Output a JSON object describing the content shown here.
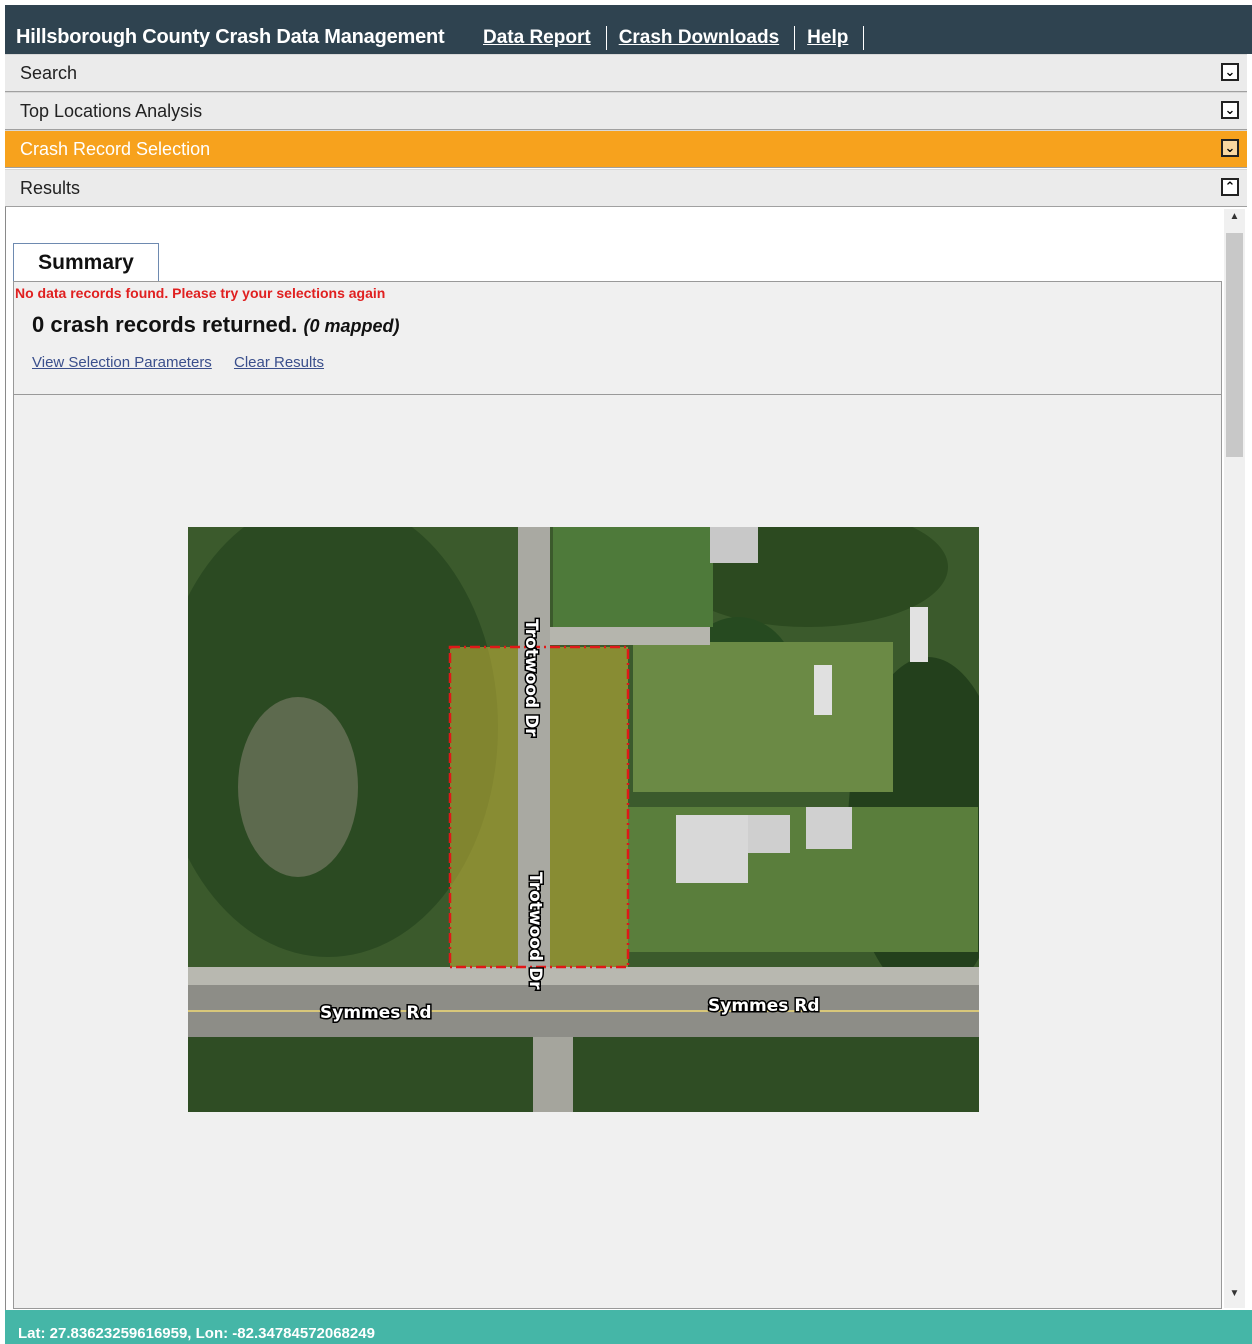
{
  "header": {
    "title": "Hillsborough County Crash Data Management",
    "nav": [
      "Data Report",
      "Crash Downloads",
      "Help"
    ]
  },
  "accordion": [
    {
      "label": "Search",
      "state": "collapsed"
    },
    {
      "label": "Top Locations Analysis",
      "state": "collapsed"
    },
    {
      "label": "Crash Record Selection",
      "state": "collapsed"
    },
    {
      "label": "Results",
      "state": "expanded"
    }
  ],
  "results": {
    "tab_label": "Summary",
    "error": "No data records found. Please try your selections again",
    "count_text": "0 crash records returned.",
    "mapped_text": "(0 mapped)",
    "links": [
      "View Selection Parameters",
      "Clear Results"
    ]
  },
  "map": {
    "labels": {
      "street_north": "Trotwood Dr",
      "street_south": "Trotwood Dr",
      "road_west": "Symmes Rd",
      "road_east": "Symmes Rd"
    }
  },
  "footer": {
    "coords": "Lat: 27.83623259616959, Lon: -82.34784572068249"
  },
  "colors": {
    "header_bg": "#2f4350",
    "active_bar": "#f7a21d",
    "footer_bg": "#45b6a7",
    "error": "#e02020"
  }
}
